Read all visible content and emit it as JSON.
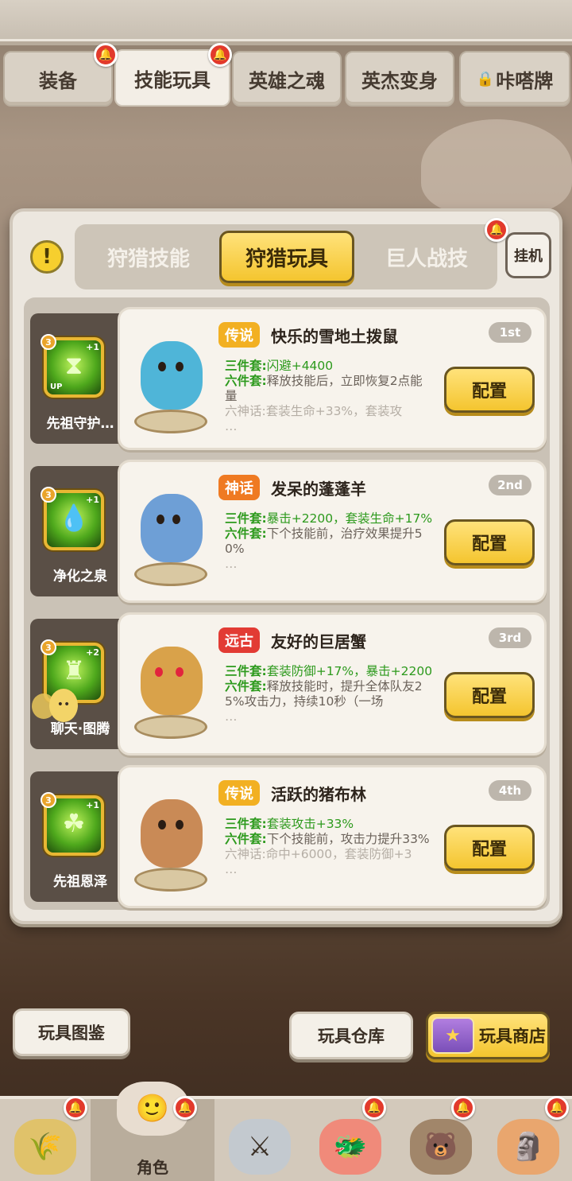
{
  "top_tabs": [
    {
      "label": "装备",
      "locked": false,
      "active": false,
      "has_alert": true
    },
    {
      "label": "技能玩具",
      "locked": false,
      "active": true,
      "has_alert": true
    },
    {
      "label": "英雄之魂",
      "locked": false,
      "active": false,
      "has_alert": false
    },
    {
      "label": "英杰变身",
      "locked": false,
      "active": false,
      "has_alert": false
    },
    {
      "label": "咔嗒牌",
      "locked": true,
      "active": false,
      "has_alert": false
    }
  ],
  "sub_tabs": [
    {
      "label": "狩猎技能",
      "active": false
    },
    {
      "label": "狩猎玩具",
      "active": true
    },
    {
      "label": "巨人战技",
      "active": false,
      "has_alert": true
    }
  ],
  "idle_button": "挂机",
  "info_icon": "!",
  "toys": [
    {
      "skill_name": "先祖守护…",
      "skill_level": "3",
      "skill_plus": "+1",
      "skill_badge": "UP",
      "rarity": "传说",
      "rarity_color": "#f2b022",
      "title": "快乐的雪地土拨鼠",
      "rank": "1st",
      "set3_label": "三件套:",
      "set3_text": "闪避+4400",
      "set6_label": "六件套:",
      "set6_text": "释放技能后，立即恢复2点能量",
      "myth_text": "六神话:套装生命+33%，套装攻",
      "more": "…",
      "config_label": "配置"
    },
    {
      "skill_name": "净化之泉",
      "skill_level": "3",
      "skill_plus": "+1",
      "skill_badge": "",
      "rarity": "神话",
      "rarity_color": "#ef7a22",
      "title": "发呆的蓬蓬羊",
      "rank": "2nd",
      "set3_label": "三件套:",
      "set3_text": "暴击+2200，套装生命+17%",
      "set6_label": "六件套:",
      "set6_text": "下个技能前，治疗效果提升50%",
      "myth_text": "",
      "more": "…",
      "config_label": "配置"
    },
    {
      "skill_name": "聊天·图腾",
      "skill_level": "3",
      "skill_plus": "+2",
      "skill_badge": "",
      "rarity": "远古",
      "rarity_color": "#e23b34",
      "title": "友好的巨居蟹",
      "rank": "3rd",
      "set3_label": "三件套:",
      "set3_text": "套装防御+17%，暴击+2200",
      "set6_label": "六件套:",
      "set6_text": "释放技能时，提升全体队友25%攻击力，持续10秒（一场",
      "myth_text": "",
      "more": "…",
      "config_label": "配置"
    },
    {
      "skill_name": "先祖恩泽",
      "skill_level": "3",
      "skill_plus": "+1",
      "skill_badge": "",
      "rarity": "传说",
      "rarity_color": "#f2b022",
      "title": "活跃的猪布林",
      "rank": "4th",
      "set3_label": "三件套:",
      "set3_text": "套装攻击+33%",
      "set6_label": "六件套:",
      "set6_text": "下个技能前，攻击力提升33%",
      "myth_text": "六神话:命中+6000，套装防御+3",
      "more": "…",
      "config_label": "配置"
    }
  ],
  "bottom_buttons": {
    "codex": "玩具图鉴",
    "warehouse": "玩具仓库",
    "shop": "玩具商店"
  },
  "bottom_nav": [
    {
      "icon": "straw-hero-icon",
      "label": "",
      "active": false,
      "has_alert": true
    },
    {
      "icon": "character-icon",
      "label": "角色",
      "active": true,
      "has_alert": true
    },
    {
      "icon": "weapon-icon",
      "label": "",
      "active": false,
      "has_alert": false
    },
    {
      "icon": "dragon-icon",
      "label": "",
      "active": false,
      "has_alert": true
    },
    {
      "icon": "bear-house-icon",
      "label": "",
      "active": false,
      "has_alert": true
    },
    {
      "icon": "totem-icon",
      "label": "",
      "active": false,
      "has_alert": true
    }
  ]
}
